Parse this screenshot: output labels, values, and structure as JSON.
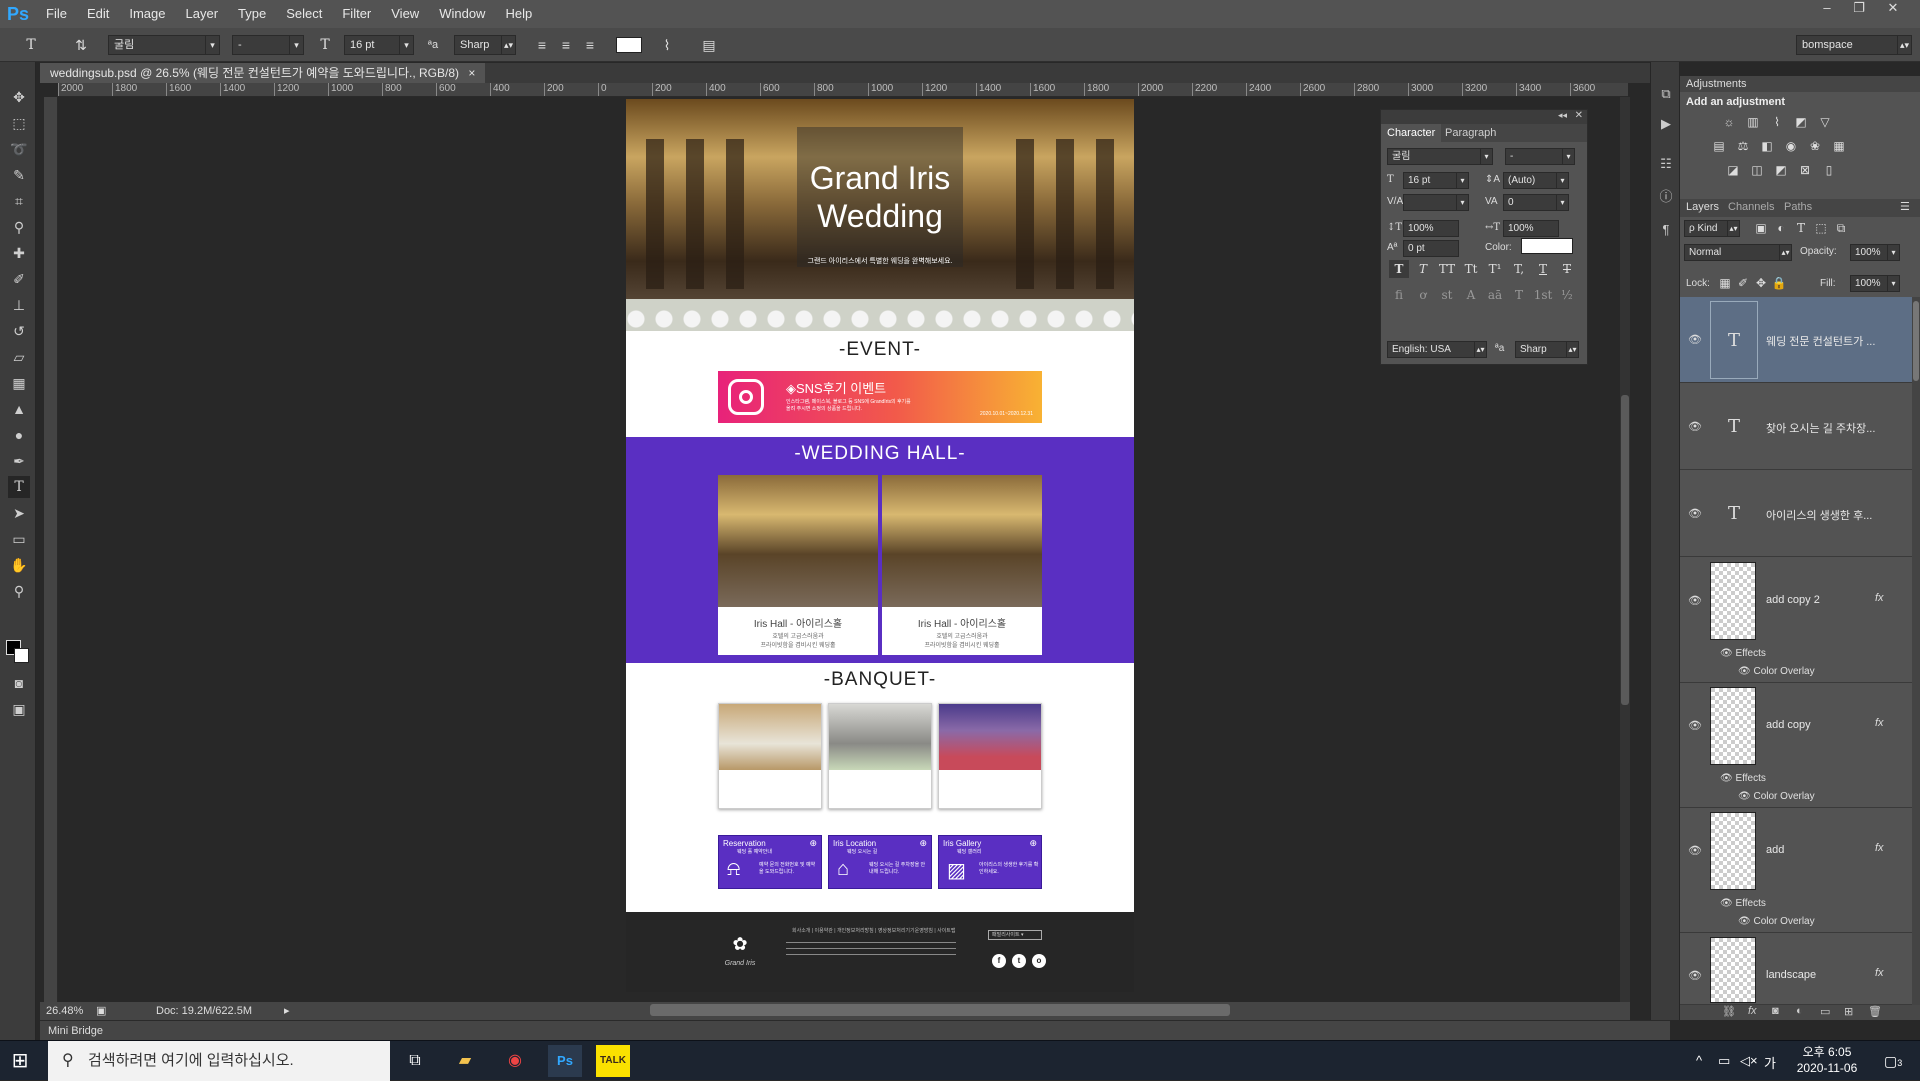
{
  "menubar": {
    "logo": "Ps",
    "items": [
      "File",
      "Edit",
      "Image",
      "Layer",
      "Type",
      "Select",
      "Filter",
      "View",
      "Window",
      "Help"
    ]
  },
  "options": {
    "font_family": "굴림",
    "font_style": "-",
    "font_size": "16 pt",
    "antialias": "Sharp",
    "workspace": "bomspace"
  },
  "document": {
    "tab_title": "weddingsub.psd @ 26.5% (웨딩 전문 컨설턴트가  예약을 도와드립니다., RGB/8)",
    "close": "×",
    "zoom": "26.48%",
    "doc_size": "Doc: 19.2M/622.5M"
  },
  "ruler": {
    "ticks": [
      "2000",
      "1800",
      "1600",
      "1400",
      "1200",
      "1000",
      "800",
      "600",
      "400",
      "200",
      "0",
      "200",
      "400",
      "600",
      "800",
      "1000",
      "1200",
      "1400",
      "1600",
      "1800",
      "2000",
      "2200",
      "2400",
      "2600",
      "2800",
      "3000",
      "3200",
      "3400",
      "3600"
    ]
  },
  "canvas": {
    "hero_title_1": "Grand Iris",
    "hero_title_2": "Wedding",
    "hero_sub": "그랜드 아이리스에서 특별한 웨딩을 완벽해보세요.",
    "event_title": "-EVENT-",
    "event_banner": "◈SNS후기 이벤트",
    "event_line_1": "인스타그램, 페이스북, 블로그 등 SNS에 GrandIris의 후기를",
    "event_line_2": "올려 주시면 소정의 상품을 드립니다.",
    "event_date": "2020.10.01~2020.12.31",
    "hall_title": "-WEDDING HALL-",
    "halls": [
      {
        "name": "Iris Hall - 아이리스홀",
        "desc_1": "호텔의 고급스러움과",
        "desc_2": "프라이빗함을 겸비시킨 웨딩홀"
      },
      {
        "name": "Iris Hall - 아이리스홀",
        "desc_1": "호텔의 고급스러움과",
        "desc_2": "프라이빗함을 겸비시킨 웨딩홀"
      }
    ],
    "banquet_title": "-BANQUET-",
    "links": [
      {
        "title": "Reservation",
        "sub": "웨딩 홀 예약안내",
        "desc": "예약 문의 전화번호 및 예약을 도와드립니다.",
        "icon": "service-bell-icon"
      },
      {
        "title": "Iris Location",
        "sub": "웨딩 오시는 길",
        "desc": "웨딩 오시는 길 주차장을 안내해 드립니다.",
        "icon": "building-icon"
      },
      {
        "title": "Iris Gallery",
        "sub": "웨딩 갤러리",
        "desc": "아이리스의 생생한 후기를 확인하세요.",
        "icon": "image-icon"
      }
    ],
    "footer_logo_text": "Grand Iris",
    "footer_menu": "회사소개 | 이용약관 | 개인정보처리방침 | 영상정보처리기기운영방침 | 사이트맵",
    "footer_select": "패밀리사이트",
    "footer_social": [
      "f",
      "t",
      "o"
    ]
  },
  "character": {
    "tabs": [
      "Character",
      "Paragraph"
    ],
    "font_family": "굴림",
    "font_style": "-",
    "size": "16 pt",
    "leading": "(Auto)",
    "kerning": "",
    "tracking": "0",
    "vscale": "100%",
    "hscale": "100%",
    "baseline": "0 pt",
    "color_label": "Color:",
    "color": "#ffffff",
    "style_buttons": [
      "T",
      "T",
      "TT",
      "Tt",
      "T¹",
      "T,",
      "T",
      "T"
    ],
    "opentype_buttons": [
      "fi",
      "ơ",
      "st",
      "A",
      "aā",
      "T",
      "1st",
      "½"
    ],
    "language": "English: USA",
    "antialias": "Sharp"
  },
  "adjustments": {
    "title": "Adjustments",
    "add": "Add an adjustment"
  },
  "layers": {
    "tabs": [
      "Layers",
      "Channels",
      "Paths"
    ],
    "kind": "ρ Kind",
    "blend": "Normal",
    "opacity_label": "Opacity:",
    "opacity": "100%",
    "lock_label": "Lock:",
    "fill_label": "Fill:",
    "fill": "100%",
    "items": [
      {
        "name": "웨딩 전문 컨설턴트가 ...",
        "type": "text",
        "selected": true
      },
      {
        "name": "찾아 오시는 길 주차장...",
        "type": "text"
      },
      {
        "name": "아이리스의 생생한 후...",
        "type": "text"
      },
      {
        "name": "add copy 2",
        "type": "shape",
        "effects": "Effects",
        "overlay": "Color Overlay"
      },
      {
        "name": "add copy",
        "type": "shape",
        "effects": "Effects",
        "overlay": "Color Overlay"
      },
      {
        "name": "add",
        "type": "shape",
        "effects": "Effects",
        "overlay": "Color Overlay"
      },
      {
        "name": "landscape",
        "type": "shape"
      }
    ]
  },
  "minibridge": "Mini Bridge",
  "taskbar": {
    "search_placeholder": "검색하려면 여기에 입력하십시오.",
    "ime": "가",
    "time": "오후 6:05",
    "date": "2020-11-06",
    "notif": "3"
  }
}
